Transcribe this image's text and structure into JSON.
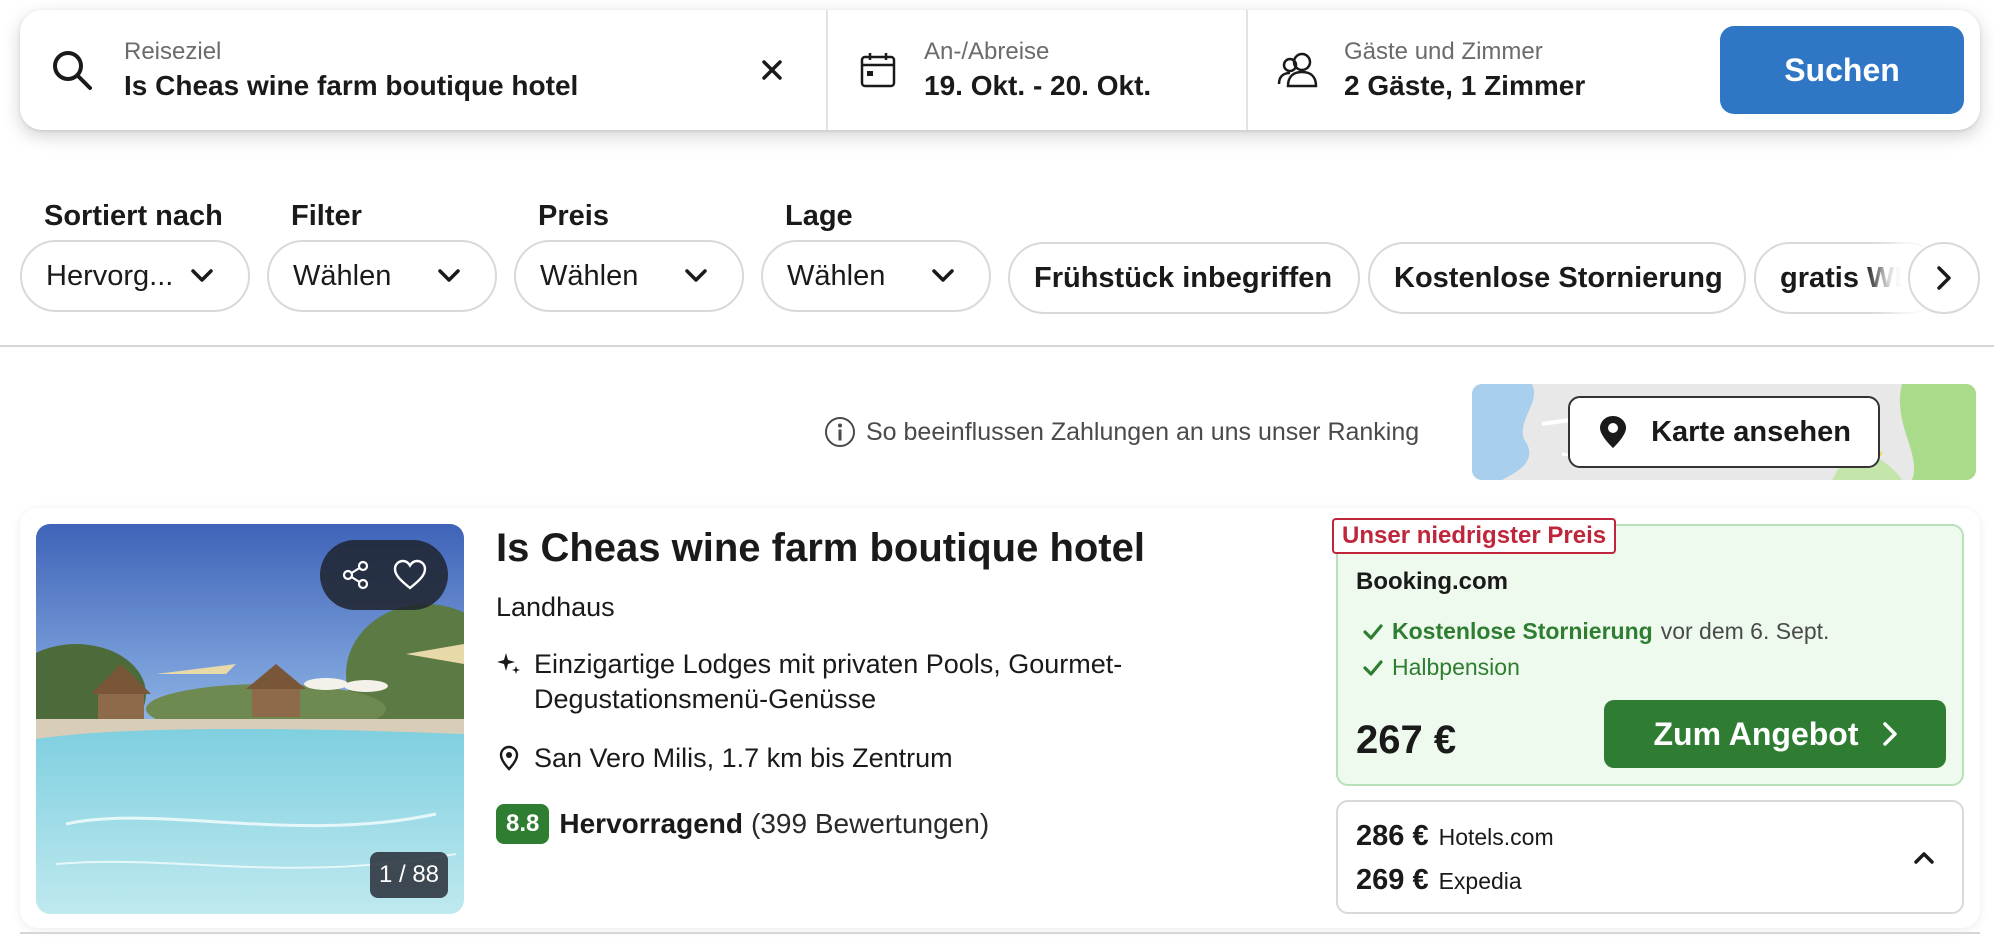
{
  "search": {
    "destination_label": "Reiseziel",
    "destination_value": "Is Cheas wine farm boutique hotel",
    "dates_label": "An-/Abreise",
    "dates_value": "19. Okt. - 20. Okt.",
    "guests_label": "Gäste und Zimmer",
    "guests_value": "2 Gäste, 1 Zimmer",
    "search_button": "Suchen"
  },
  "filters": {
    "sort": {
      "label": "Sortiert nach",
      "value": "Hervorg..."
    },
    "filter": {
      "label": "Filter",
      "value": "Wählen"
    },
    "price": {
      "label": "Preis",
      "value": "Wählen"
    },
    "location": {
      "label": "Lage",
      "value": "Wählen"
    },
    "chips": [
      "Frühstück inbegriffen",
      "Kostenlose Stornierung",
      "gratis WL"
    ]
  },
  "ranking_info": "So beeinflussen Zahlungen an uns unser Ranking",
  "map_button": "Karte ansehen",
  "hotel": {
    "name": "Is Cheas wine farm boutique hotel",
    "type": "Landhaus",
    "feature": "Einzigartige Lodges mit privaten Pools, Gourmet-Degustationsmenü-Genüsse",
    "location": "San Vero Milis, 1.7 km bis Zentrum",
    "rating_score": "8.8",
    "rating_word": "Hervorragend",
    "rating_count": "(399 Bewertungen)",
    "image_counter": "1 / 88"
  },
  "offer": {
    "tag": "Unser niedrigster Preis",
    "provider": "Booking.com",
    "cancellation": "Kostenlose Stornierung",
    "cancellation_suffix": "vor dem 6. Sept.",
    "board": "Halbpension",
    "price": "267 €",
    "deal_button": "Zum Angebot"
  },
  "alt_prices": [
    {
      "price": "286 €",
      "provider": "Hotels.com"
    },
    {
      "price": "269 €",
      "provider": "Expedia"
    }
  ],
  "colors": {
    "primary_blue": "#2f76c5",
    "deal_green": "#2e7d32",
    "tag_red": "#c0263b",
    "offer_bg": "#eefaee"
  }
}
